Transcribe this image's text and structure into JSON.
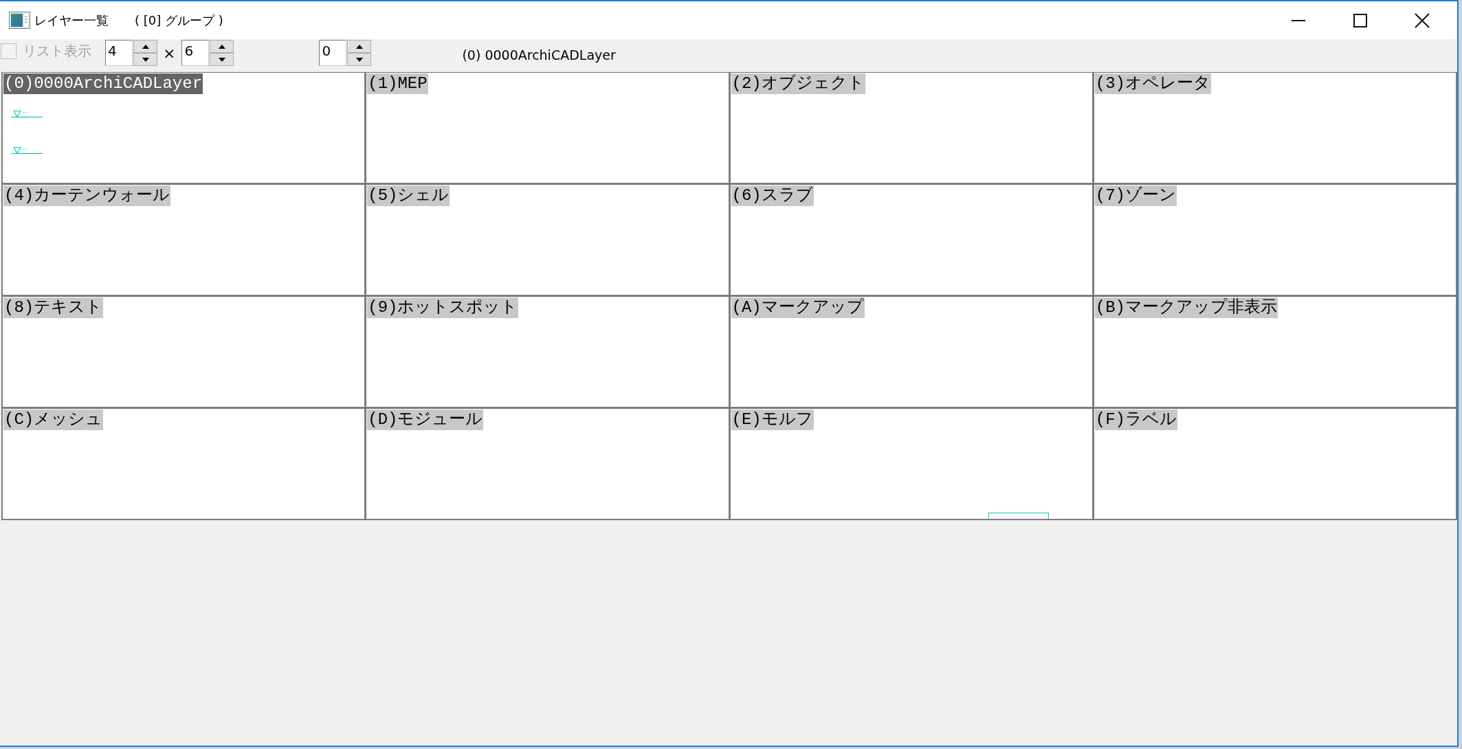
{
  "window": {
    "title": "レイヤー一覧",
    "subtitle": "( [0] グループ )"
  },
  "toolbar": {
    "list_view": {
      "label": "リスト表示",
      "checked": false,
      "disabled": true
    },
    "columns": {
      "value": "4"
    },
    "times": "×",
    "rows": {
      "value": "6"
    },
    "offset": {
      "value": "0"
    },
    "current_layer": "(0) 0000ArchiCADLayer"
  },
  "grid": {
    "cells": [
      {
        "label": "(0)0000ArchiCADLayer",
        "selected": true,
        "kind": "level-markers"
      },
      {
        "label": "(1)MEP",
        "selected": false,
        "kind": "empty"
      },
      {
        "label": "(2)オブジェクト",
        "selected": false,
        "kind": "empty"
      },
      {
        "label": "(3)オペレータ",
        "selected": false,
        "kind": "empty"
      },
      {
        "label": "(4)カーテンウォール",
        "selected": false,
        "kind": "empty"
      },
      {
        "label": "(5)シェル",
        "selected": false,
        "kind": "empty"
      },
      {
        "label": "(6)スラブ",
        "selected": false,
        "kind": "empty"
      },
      {
        "label": "(7)ゾーン",
        "selected": false,
        "kind": "empty"
      },
      {
        "label": "(8)テキスト",
        "selected": false,
        "kind": "empty"
      },
      {
        "label": "(9)ホットスポット",
        "selected": false,
        "kind": "empty"
      },
      {
        "label": "(A)マークアップ",
        "selected": false,
        "kind": "empty"
      },
      {
        "label": "(B)マークアップ非表示",
        "selected": false,
        "kind": "empty"
      },
      {
        "label": "(C)メッシュ",
        "selected": false,
        "kind": "empty"
      },
      {
        "label": "(D)モジュール",
        "selected": false,
        "kind": "empty"
      },
      {
        "label": "(E)モルフ",
        "selected": false,
        "kind": "outline"
      },
      {
        "label": "(F)ラベル",
        "selected": false,
        "kind": "empty"
      }
    ]
  }
}
